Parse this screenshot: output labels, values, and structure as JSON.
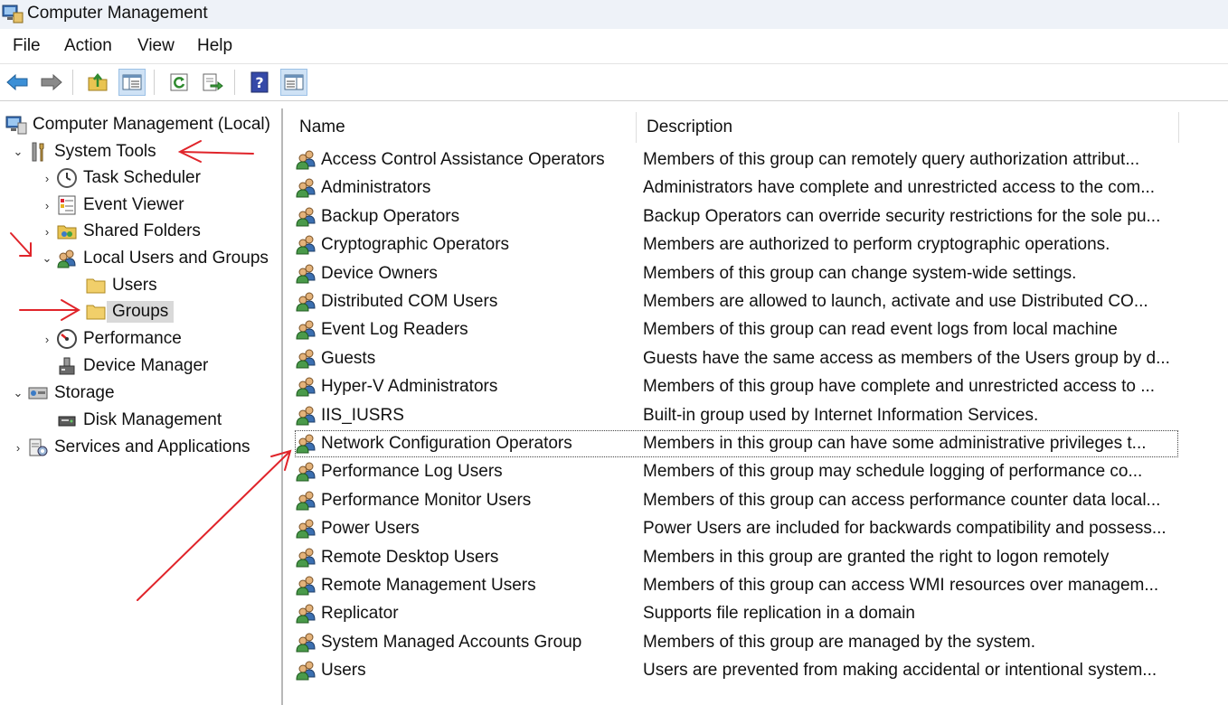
{
  "window": {
    "title": "Computer Management"
  },
  "menu": [
    "File",
    "Action",
    "View",
    "Help"
  ],
  "toolbar": [
    "back-icon",
    "forward-icon",
    "up-folder-icon",
    "show-hide-tree-icon",
    "refresh-icon",
    "export-list-icon",
    "help-icon",
    "show-action-pane-icon"
  ],
  "tree": {
    "root": "Computer Management (Local)",
    "system_tools": "System Tools",
    "task_scheduler": "Task Scheduler",
    "event_viewer": "Event Viewer",
    "shared_folders": "Shared Folders",
    "local_users_groups": "Local Users and Groups",
    "users": "Users",
    "groups": "Groups",
    "performance": "Performance",
    "device_manager": "Device Manager",
    "storage": "Storage",
    "disk_management": "Disk Management",
    "services_apps": "Services and Applications"
  },
  "columns": {
    "name": "Name",
    "description": "Description"
  },
  "groups": [
    {
      "name": "Access Control Assistance Operators",
      "description": "Members of this group can remotely query authorization attribut..."
    },
    {
      "name": "Administrators",
      "description": "Administrators have complete and unrestricted access to the com..."
    },
    {
      "name": "Backup Operators",
      "description": "Backup Operators can override security restrictions for the sole pu..."
    },
    {
      "name": "Cryptographic Operators",
      "description": "Members are authorized to perform cryptographic operations."
    },
    {
      "name": "Device Owners",
      "description": "Members of this group can change system-wide settings."
    },
    {
      "name": "Distributed COM Users",
      "description": "Members are allowed to launch, activate and use Distributed CO..."
    },
    {
      "name": "Event Log Readers",
      "description": "Members of this group can read event logs from local machine"
    },
    {
      "name": "Guests",
      "description": "Guests have the same access as members of the Users group by d..."
    },
    {
      "name": "Hyper-V Administrators",
      "description": "Members of this group have complete and unrestricted access to ..."
    },
    {
      "name": "IIS_IUSRS",
      "description": "Built-in group used by Internet Information Services."
    },
    {
      "name": "Network Configuration Operators",
      "description": "Members in this group can have some administrative privileges t..."
    },
    {
      "name": "Performance Log Users",
      "description": "Members of this group may schedule logging of performance co..."
    },
    {
      "name": "Performance Monitor Users",
      "description": "Members of this group can access performance counter data local..."
    },
    {
      "name": "Power Users",
      "description": "Power Users are included for backwards compatibility and possess..."
    },
    {
      "name": "Remote Desktop Users",
      "description": "Members in this group are granted the right to logon remotely"
    },
    {
      "name": "Remote Management Users",
      "description": "Members of this group can access WMI resources over managem..."
    },
    {
      "name": "Replicator",
      "description": "Supports file replication in a domain"
    },
    {
      "name": "System Managed Accounts Group",
      "description": "Members of this group are managed by the system."
    },
    {
      "name": "Users",
      "description": "Users are prevented from making accidental or intentional system..."
    }
  ],
  "colors": {
    "annotation_arrow": "#e0242a",
    "selection": "#d9d9d9"
  }
}
